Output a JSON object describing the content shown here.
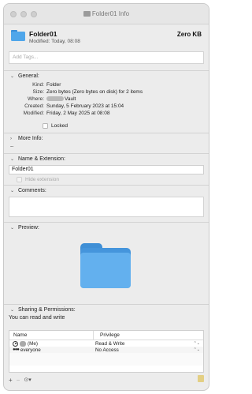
{
  "window": {
    "title": "Folder01 Info"
  },
  "header": {
    "name": "Folder01",
    "size": "Zero KB",
    "modified": "Modified: Today, 08:08"
  },
  "tags": {
    "placeholder": "Add Tags..."
  },
  "general": {
    "label": "General:",
    "kind_label": "Kind:",
    "kind_value": "Folder",
    "size_label": "Size:",
    "size_value": "Zero bytes (Zero bytes on disk) for 2 items",
    "where_label": "Where:",
    "where_value": "Vault",
    "created_label": "Created:",
    "created_value": "Sunday, 5 February 2023 at 15:04",
    "modified_label": "Modified:",
    "modified_value": "Friday, 2 May 2025 at 08:08",
    "locked_label": "Locked"
  },
  "more_info": {
    "label": "More Info:",
    "value": "--"
  },
  "name_ext": {
    "label": "Name & Extension:",
    "value": "Folder01",
    "hide_extension": "Hide extension"
  },
  "comments": {
    "label": "Comments:"
  },
  "preview": {
    "label": "Preview:"
  },
  "sharing": {
    "label": "Sharing & Permissions:",
    "status": "You can read and write",
    "col_name": "Name",
    "col_privilege": "Privilege",
    "rows": [
      {
        "name": "(Me)",
        "privilege": "Read & Write",
        "icon": "user-icon"
      },
      {
        "name": "everyone",
        "privilege": "No Access",
        "icon": "group-icon"
      }
    ]
  },
  "toolbar": {
    "add": "+",
    "remove": "−",
    "action": "⊙",
    "action_chevron": "▾"
  }
}
